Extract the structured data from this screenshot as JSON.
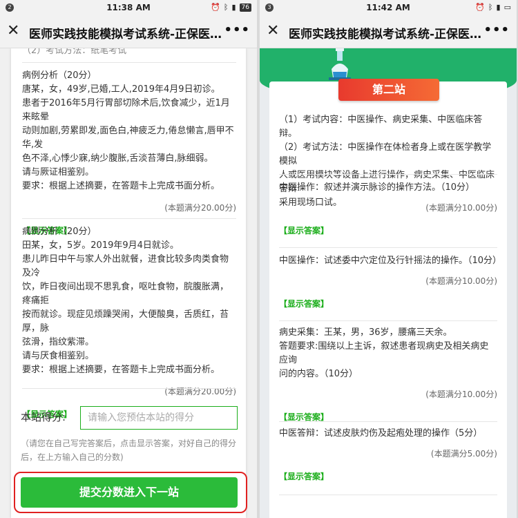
{
  "left": {
    "status": {
      "notif": "2",
      "time": "11:38 AM",
      "battery": "76"
    },
    "nav": {
      "title": "医师实践技能模拟考试系统-正保医…",
      "more": "•••"
    },
    "cut_text": "（2）考试方法：纸笔考试",
    "cases": [
      {
        "lines": [
          "病例分析（20分）",
          "唐某，女，49岁,已婚,工人,2019年4月9日初诊。",
          "患者于2016年5月行胃部切除术后,饮食减少，近1月来眩晕",
          "动则加剧,劳累即发,面色白,神疲乏力,倦怠懒言,唇甲不华,发",
          "色不泽,心悸少寐,纳少腹胀,舌淡苔薄白,脉细弱。",
          "请与厥证相鉴别。",
          "要求：根据上述摘要，在答题卡上完成书面分析。"
        ],
        "score": "(本题满分20.00分)",
        "answer": "【显示答案】"
      },
      {
        "lines": [
          "病例分析（20分）",
          "田某，女，5岁。2019年9月4日就诊。",
          "患儿昨日中午与家人外出就餐，进食比较多肉类食物及冷",
          "饮，昨日夜间出现不思乳食，呕吐食物，脘腹胀满，疼痛拒",
          "按而就诊。现症见烦躁哭闹，大便酸臭，舌质红，苔厚，脉",
          "弦滑，指纹紫滞。",
          "请与厌食相鉴别。",
          "要求：根据上述摘要，在答题卡上完成书面分析。"
        ],
        "score": "(本题满分20.00分)",
        "answer": "【显示答案】"
      }
    ],
    "score_label": "本站得分:",
    "score_placeholder": "请输入您预估本站的得分",
    "hint": "（请您在自己写完答案后，点击显示答案，对好自己的得分后，在上方输入自己的分数)",
    "submit": "提交分数进入下一站"
  },
  "right": {
    "status": {
      "notif": "3",
      "time": "11:42 AM"
    },
    "nav": {
      "title": "医师实践技能模拟考试系统-正保医…",
      "more": "•••"
    },
    "station_title": "第二站",
    "intro": [
      "（1）考试内容：中医操作、病史采集、中医临床答辩。",
      "（2）考试方法：中医操作在体检者身上或在医学教学模拟",
      "人或医用模块等设备上进行操作，病史采集、中医临床答辩",
      "采用现场口试。"
    ],
    "items": [
      {
        "lines": [
          "中医操作：叙述并演示脉诊的操作方法。（10分）"
        ],
        "score": "(本题满分10.00分)",
        "answer": "【显示答案】"
      },
      {
        "lines": [
          "中医操作：试述委中穴定位及行针摇法的操作。（10分）"
        ],
        "score": "(本题满分10.00分)",
        "answer": "【显示答案】"
      },
      {
        "lines": [
          "病史采集：王某，男，36岁，腰痛三天余。",
          "答题要求:围绕以上主诉，叙述患者现病史及相关病史应询",
          "问的内容。（10分）"
        ],
        "score": "(本题满分10.00分)",
        "answer": "【显示答案】"
      },
      {
        "lines": [
          "中医答辩：试述皮肤灼伤及起疱处理的操作（5分）"
        ],
        "score": "(本题满分5.00分)",
        "answer": "【显示答案】"
      }
    ]
  }
}
